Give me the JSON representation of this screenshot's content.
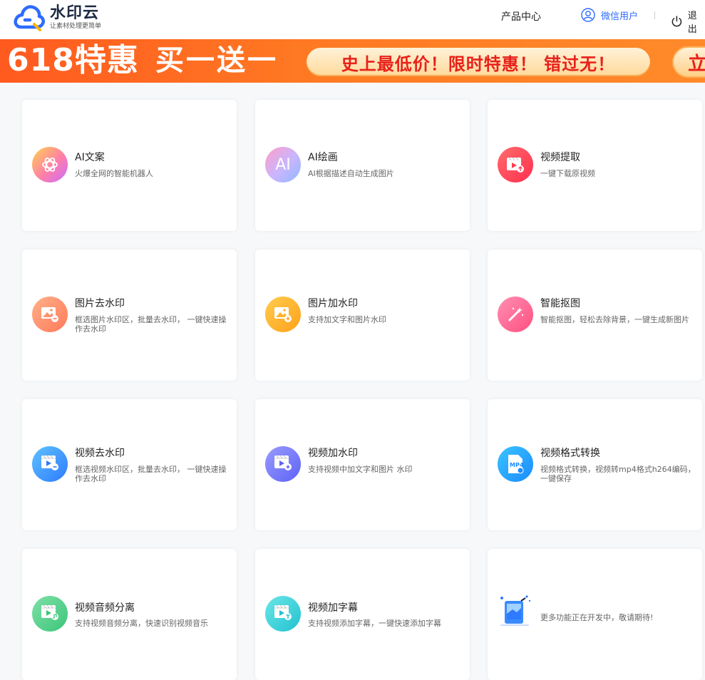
{
  "header": {
    "logo_title": "水印云",
    "logo_sub": "让素材处理更简单",
    "nav_product": "产品中心",
    "nav_user": "微信用户",
    "nav_logout": "退出"
  },
  "banner": {
    "promo": "618特惠",
    "bogo": "买一送一",
    "slogan": "史上最低价！限时特惠！ 错过无！",
    "cta": "立"
  },
  "tools": [
    {
      "title": "AI文案",
      "desc": "火爆全网的智能机器人",
      "icon": "openai-icon"
    },
    {
      "title": "AI绘画",
      "desc": "AI根据描述自动生成图片",
      "icon": "ai-text-icon",
      "icon_text": "AI"
    },
    {
      "title": "视频提取",
      "desc": "一键下载原视频",
      "icon": "video-download-icon"
    },
    {
      "title": "图片去水印",
      "desc": "框选图片水印区，批量去水印， 一键快速操作去水印",
      "icon": "image-remove-icon"
    },
    {
      "title": "图片加水印",
      "desc": "支持加文字和图片水印",
      "icon": "image-add-icon"
    },
    {
      "title": "智能抠图",
      "desc": "智能抠图，轻松去除背景，一键生成新图片",
      "icon": "magic-wand-icon"
    },
    {
      "title": "视频去水印",
      "desc": "框选视频水印区，批量去水印， 一键快速操作去水印",
      "icon": "video-remove-icon"
    },
    {
      "title": "视频加水印",
      "desc": "支持视频中加文字和图片 水印",
      "icon": "video-add-icon"
    },
    {
      "title": "视频格式转换",
      "desc": "视频格式转换，视频转mp4格式h264编码，一键保存",
      "icon": "mp4-file-icon",
      "icon_text": "MP4"
    },
    {
      "title": "视频音频分离",
      "desc": "支持视频音频分离，快速识别视频音乐",
      "icon": "video-audio-icon"
    },
    {
      "title": "视频加字幕",
      "desc": "支持视频添加字幕，一键快速添加字幕",
      "icon": "video-subtitle-icon"
    },
    {
      "title": "",
      "desc": "更多功能正在开发中，敬请期待!",
      "icon": "coming-soon-illustration-icon"
    }
  ],
  "colors": {
    "brand_blue": "#2e6bff",
    "banner_orange": "#ff6a21",
    "promo_red": "#e8211a"
  }
}
